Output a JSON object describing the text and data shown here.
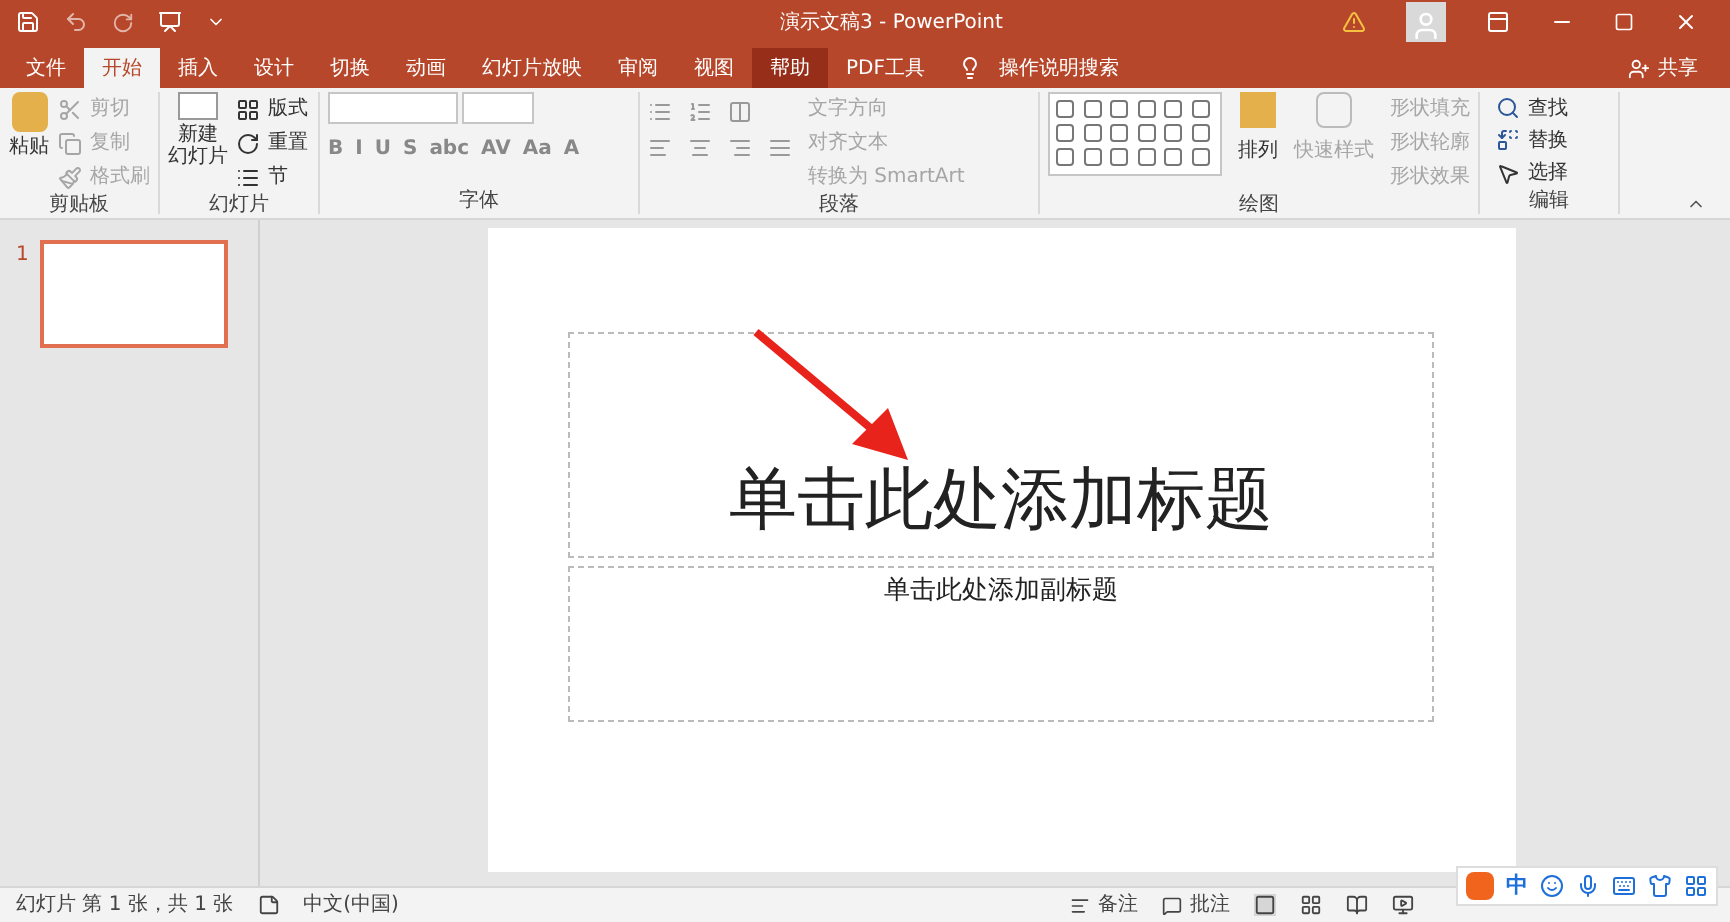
{
  "window": {
    "title": "演示文稿3 - PowerPoint",
    "share": "共享"
  },
  "tabs": [
    {
      "label": "文件",
      "selected": false
    },
    {
      "label": "开始",
      "selected": true
    },
    {
      "label": "插入",
      "selected": false
    },
    {
      "label": "设计",
      "selected": false
    },
    {
      "label": "切换",
      "selected": false
    },
    {
      "label": "动画",
      "selected": false
    },
    {
      "label": "幻灯片放映",
      "selected": false
    },
    {
      "label": "审阅",
      "selected": false
    },
    {
      "label": "视图",
      "selected": false
    },
    {
      "label": "帮助",
      "selected": false,
      "highlighted": true
    },
    {
      "label": "PDF工具",
      "selected": false,
      "highlighted": false
    }
  ],
  "tell_me": "操作说明搜索",
  "clipboard": {
    "paste": "粘贴",
    "cut": "剪切",
    "copy": "复制",
    "format_painter": "格式刷",
    "label": "剪贴板"
  },
  "slides_group": {
    "new_slide_1": "新建",
    "new_slide_2": "幻灯片",
    "layout": "版式",
    "reset": "重置",
    "section": "节",
    "label": "幻灯片"
  },
  "font_group": {
    "label": "字体",
    "buttons": [
      "B",
      "I",
      "U",
      "S",
      "abc",
      "AV",
      "Aa",
      "A"
    ]
  },
  "paragraph_group": {
    "text_direction": "文字方向",
    "align_text": "对齐文本",
    "smartart": "转换为 SmartArt",
    "label": "段落"
  },
  "drawing_group": {
    "arrange": "排列",
    "quick_styles": "快速样式",
    "fill": "形状填充",
    "outline": "形状轮廓",
    "effects": "形状效果",
    "label": "绘图"
  },
  "editing_group": {
    "find": "查找",
    "replace": "替换",
    "select": "选择",
    "label": "编辑"
  },
  "thumbnails": [
    {
      "number": "1",
      "selected": true
    }
  ],
  "slide": {
    "title_placeholder": "单击此处添加标题",
    "subtitle_placeholder": "单击此处添加副标题"
  },
  "status_bar": {
    "slide_info": "幻灯片 第 1 张，共 1 张",
    "language": "中文(中国)",
    "notes": "备注",
    "comments": "批注"
  },
  "ime": {
    "mode": "中"
  }
}
